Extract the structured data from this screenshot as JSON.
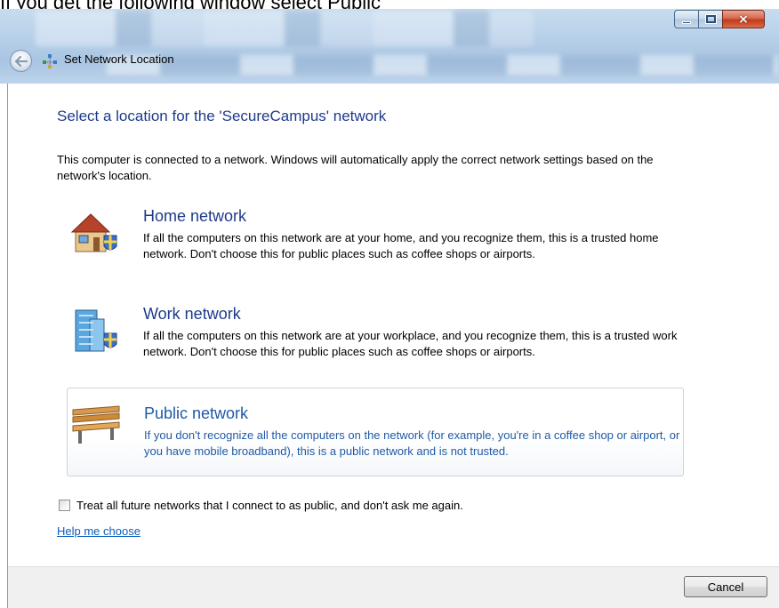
{
  "caption": "If you get the following window select Public",
  "window": {
    "title": "Set Network Location",
    "controls": {
      "minimize": "minimize",
      "maximize": "maximize",
      "close": "×"
    }
  },
  "dialog": {
    "heading": "Select a location for the 'SecureCampus' network",
    "intro": "This computer is connected to a network. Windows will automatically apply the correct network settings based on the network's location.",
    "options": [
      {
        "title": "Home network",
        "description": "If all the computers on this network are at your home, and you recognize them, this is a trusted home network.  Don't choose this for public places such as coffee shops or airports.",
        "icon": "home-network-icon",
        "selected": false
      },
      {
        "title": "Work network",
        "description": "If all the computers on this network are at your workplace, and you recognize them, this is a trusted work network.  Don't choose this for public places such as coffee shops or airports.",
        "icon": "work-network-icon",
        "selected": false
      },
      {
        "title": "Public network",
        "description": "If you don't recognize all the computers on the network (for example, you're in a coffee shop or airport, or you have mobile broadband), this is a public network and is not trusted.",
        "icon": "public-network-icon",
        "selected": true
      }
    ],
    "checkbox_label": "Treat all future networks that I connect to as public, and don't ask me again.",
    "checkbox_checked": false,
    "help_link": "Help me choose",
    "cancel_label": "Cancel"
  },
  "colors": {
    "heading": "#1e3a8a",
    "selected_text": "#1e5aa8",
    "link": "#0b5ebd",
    "footer": "#f0f0f0"
  }
}
